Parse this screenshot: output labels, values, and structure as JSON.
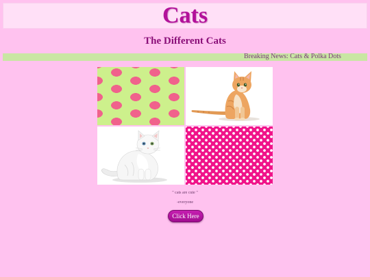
{
  "header": {
    "title": "Cats"
  },
  "subtitle": "The Different Cats",
  "ticker": {
    "text": "Breaking News: Cats & Polka Dots"
  },
  "gallery": {
    "images": [
      {
        "pattern": "green-pink-polka-dots",
        "colors": [
          "#cdf08c",
          "#f0628c"
        ]
      },
      {
        "subject": "orange tabby kitten sitting"
      },
      {
        "subject": "white fluffy cat sitting"
      },
      {
        "pattern": "pink-white-polka-dots",
        "colors": [
          "#f0148a",
          "#ffffff"
        ]
      }
    ]
  },
  "quote": {
    "text": "\" cats are cute \"",
    "attribution": "-everyone"
  },
  "cta": {
    "label": "Click Here"
  },
  "colors": {
    "background": "#ffc2ef",
    "title": "#b2119a",
    "ticker_bg": "#c9e6a3",
    "button": "#b8169f"
  }
}
